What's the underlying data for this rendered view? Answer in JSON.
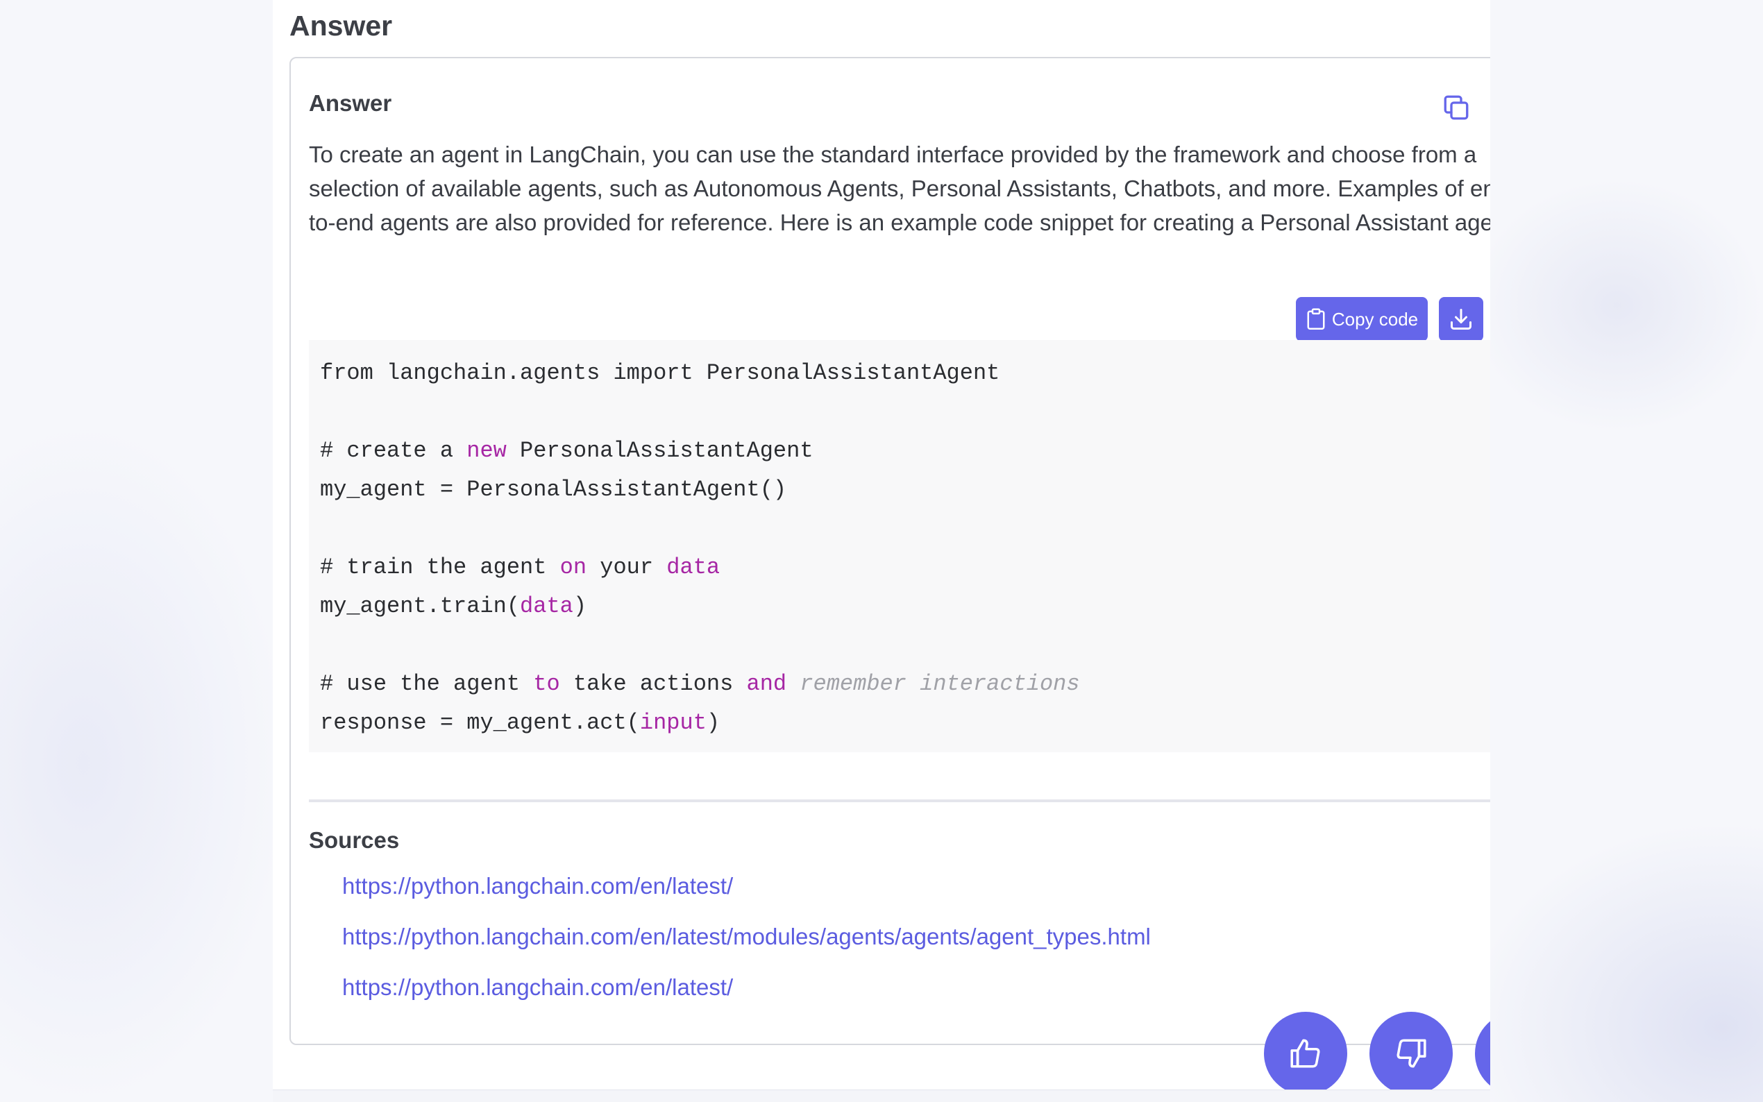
{
  "section": {
    "title": "Answer"
  },
  "answer_card": {
    "title": "Answer",
    "copy_icon": "copy-icon",
    "body": "To create an agent in LangChain, you can use the standard interface provided by the framework and choose from a selection of available agents, such as Autonomous Agents, Personal Assistants, Chatbots, and more. Examples of end-to-end agents are also provided for reference. Here is an example code snippet for creating a Personal Assistant agent:"
  },
  "code_toolbar": {
    "copy_label": "Copy code",
    "copy_icon": "clipboard-icon",
    "download_icon": "download-icon"
  },
  "code": {
    "language": "python",
    "lines": [
      [
        {
          "t": "from langchain.agents import PersonalAssistantAgent",
          "c": ""
        }
      ],
      [],
      [
        {
          "t": "# create a ",
          "c": ""
        },
        {
          "t": "new",
          "c": "kw"
        },
        {
          "t": " PersonalAssistantAgent",
          "c": ""
        }
      ],
      [
        {
          "t": "my_agent = PersonalAssistantAgent()",
          "c": ""
        }
      ],
      [],
      [
        {
          "t": "# train the agent ",
          "c": ""
        },
        {
          "t": "on",
          "c": "kw"
        },
        {
          "t": " your ",
          "c": ""
        },
        {
          "t": "data",
          "c": "kw"
        }
      ],
      [
        {
          "t": "my_agent.train(",
          "c": ""
        },
        {
          "t": "data",
          "c": "kw"
        },
        {
          "t": ")",
          "c": ""
        }
      ],
      [],
      [
        {
          "t": "# use the agent ",
          "c": ""
        },
        {
          "t": "to",
          "c": "kw"
        },
        {
          "t": " take actions ",
          "c": ""
        },
        {
          "t": "and",
          "c": "kw"
        },
        {
          "t": " ",
          "c": ""
        },
        {
          "t": "remember interactions",
          "c": "cm"
        }
      ],
      [
        {
          "t": "response = my_agent.act(",
          "c": ""
        },
        {
          "t": "input",
          "c": "kw"
        },
        {
          "t": ")",
          "c": ""
        }
      ]
    ]
  },
  "sources": {
    "title": "Sources",
    "links": [
      "https://python.langchain.com/en/latest/",
      "https://python.langchain.com/en/latest/modules/agents/agents/agent_types.html",
      "https://python.langchain.com/en/latest/"
    ]
  },
  "feedback": {
    "like_icon": "thumbs-up-icon",
    "dislike_icon": "thumbs-down-icon",
    "more_icon": "more-icon"
  },
  "colors": {
    "accent": "#6566ea",
    "link": "#5b5ce0",
    "code_keyword": "#a626a4",
    "code_comment": "#a0a1a7",
    "code_background": "#f8f8f9"
  }
}
